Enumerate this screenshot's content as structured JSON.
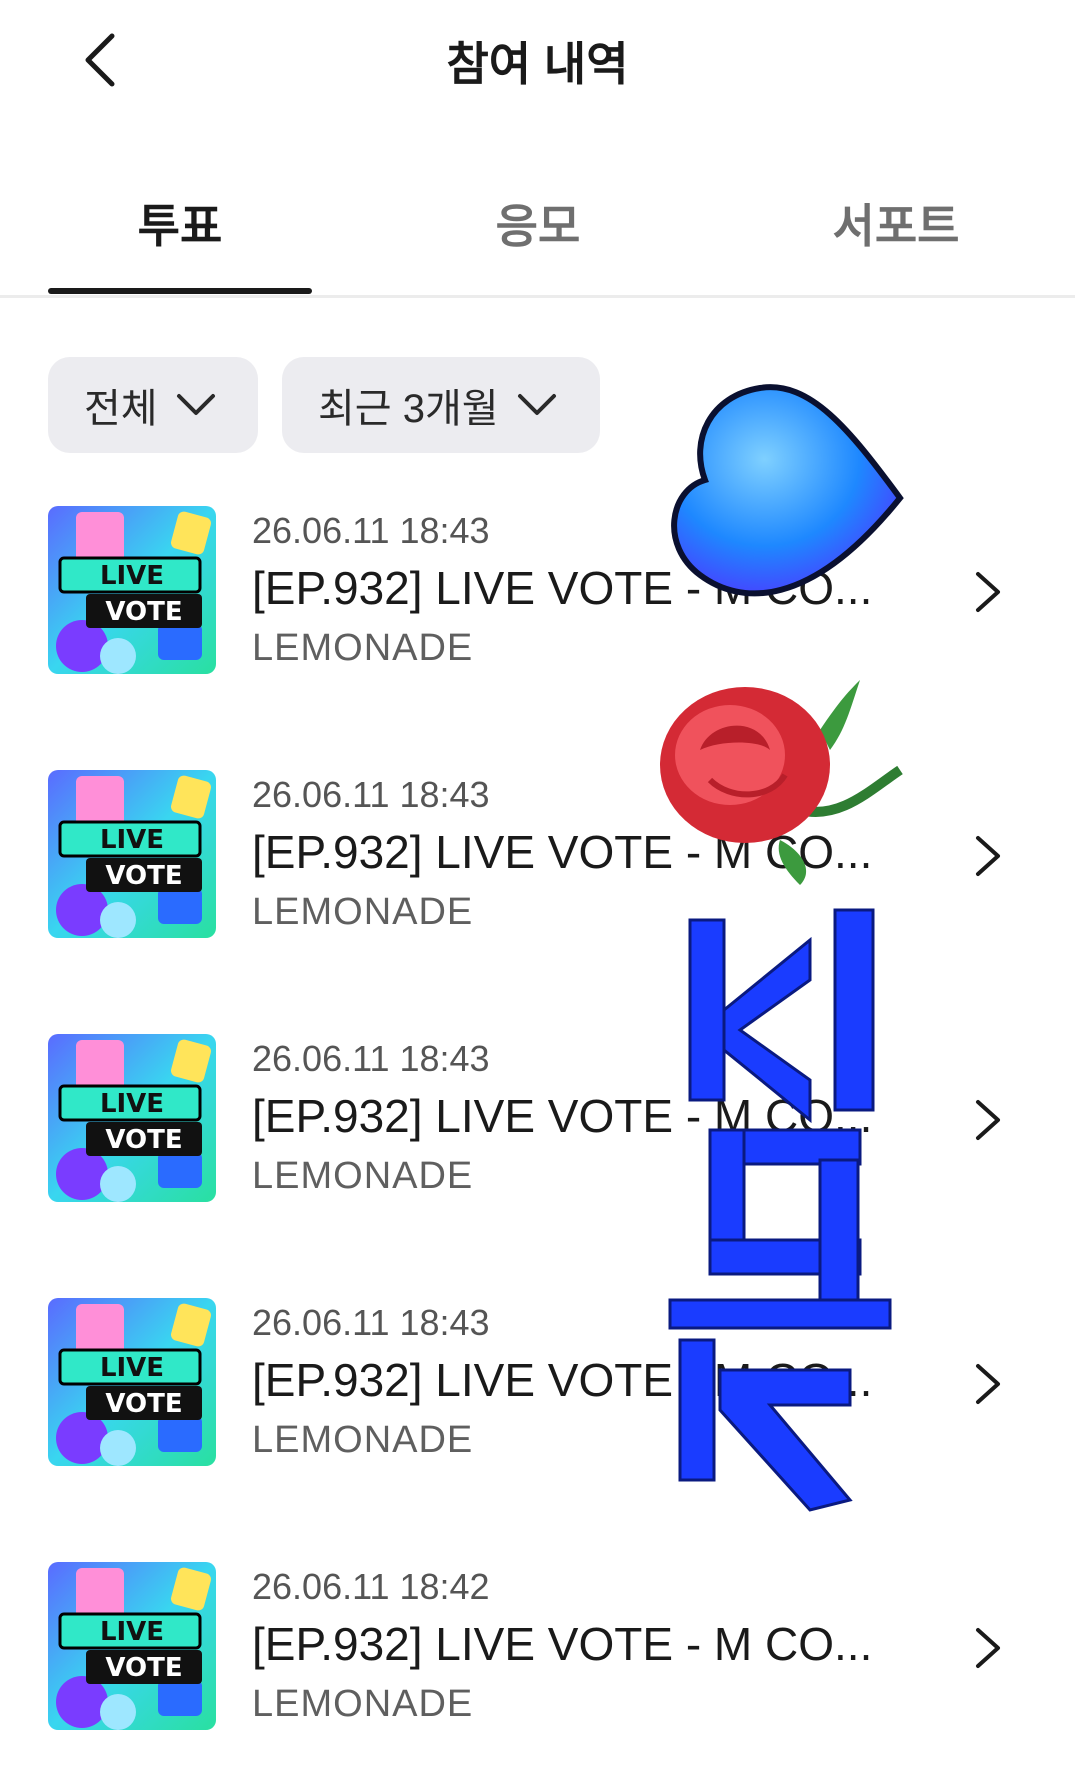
{
  "header": {
    "title": "참여 내역",
    "back_icon": "chevron-left-icon"
  },
  "tabs": [
    {
      "label": "투표",
      "active": true
    },
    {
      "label": "응모",
      "active": false
    },
    {
      "label": "서포트",
      "active": false
    }
  ],
  "filters": [
    {
      "label": "전체",
      "icon": "chevron-down-icon"
    },
    {
      "label": "최근 3개월",
      "icon": "chevron-down-icon"
    }
  ],
  "items": [
    {
      "date": "26.06.11 18:43",
      "title": "[EP.932] LIVE VOTE - M CO...",
      "artist": "LEMONADE",
      "thumb_line1": "LIVE",
      "thumb_line2": "VOTE"
    },
    {
      "date": "26.06.11 18:43",
      "title": "[EP.932] LIVE VOTE - M CO...",
      "artist": "LEMONADE",
      "thumb_line1": "LIVE",
      "thumb_line2": "VOTE"
    },
    {
      "date": "26.06.11 18:43",
      "title": "[EP.932] LIVE VOTE - M CO...",
      "artist": "LEMONADE",
      "thumb_line1": "LIVE",
      "thumb_line2": "VOTE"
    },
    {
      "date": "26.06.11 18:43",
      "title": "[EP.932] LIVE VOTE - M CO...",
      "artist": "LEMONADE",
      "thumb_line1": "LIVE",
      "thumb_line2": "VOTE"
    },
    {
      "date": "26.06.11 18:42",
      "title": "[EP.932] LIVE VOTE - M CO...",
      "artist": "LEMONADE",
      "thumb_line1": "LIVE",
      "thumb_line2": "VOTE"
    }
  ],
  "colors": {
    "accent": "#1a1a1a",
    "chip_bg": "#ececf0",
    "heart_blue": "#1e88ff",
    "rose_red": "#e0303a",
    "deco_blue": "#1a3cff"
  }
}
